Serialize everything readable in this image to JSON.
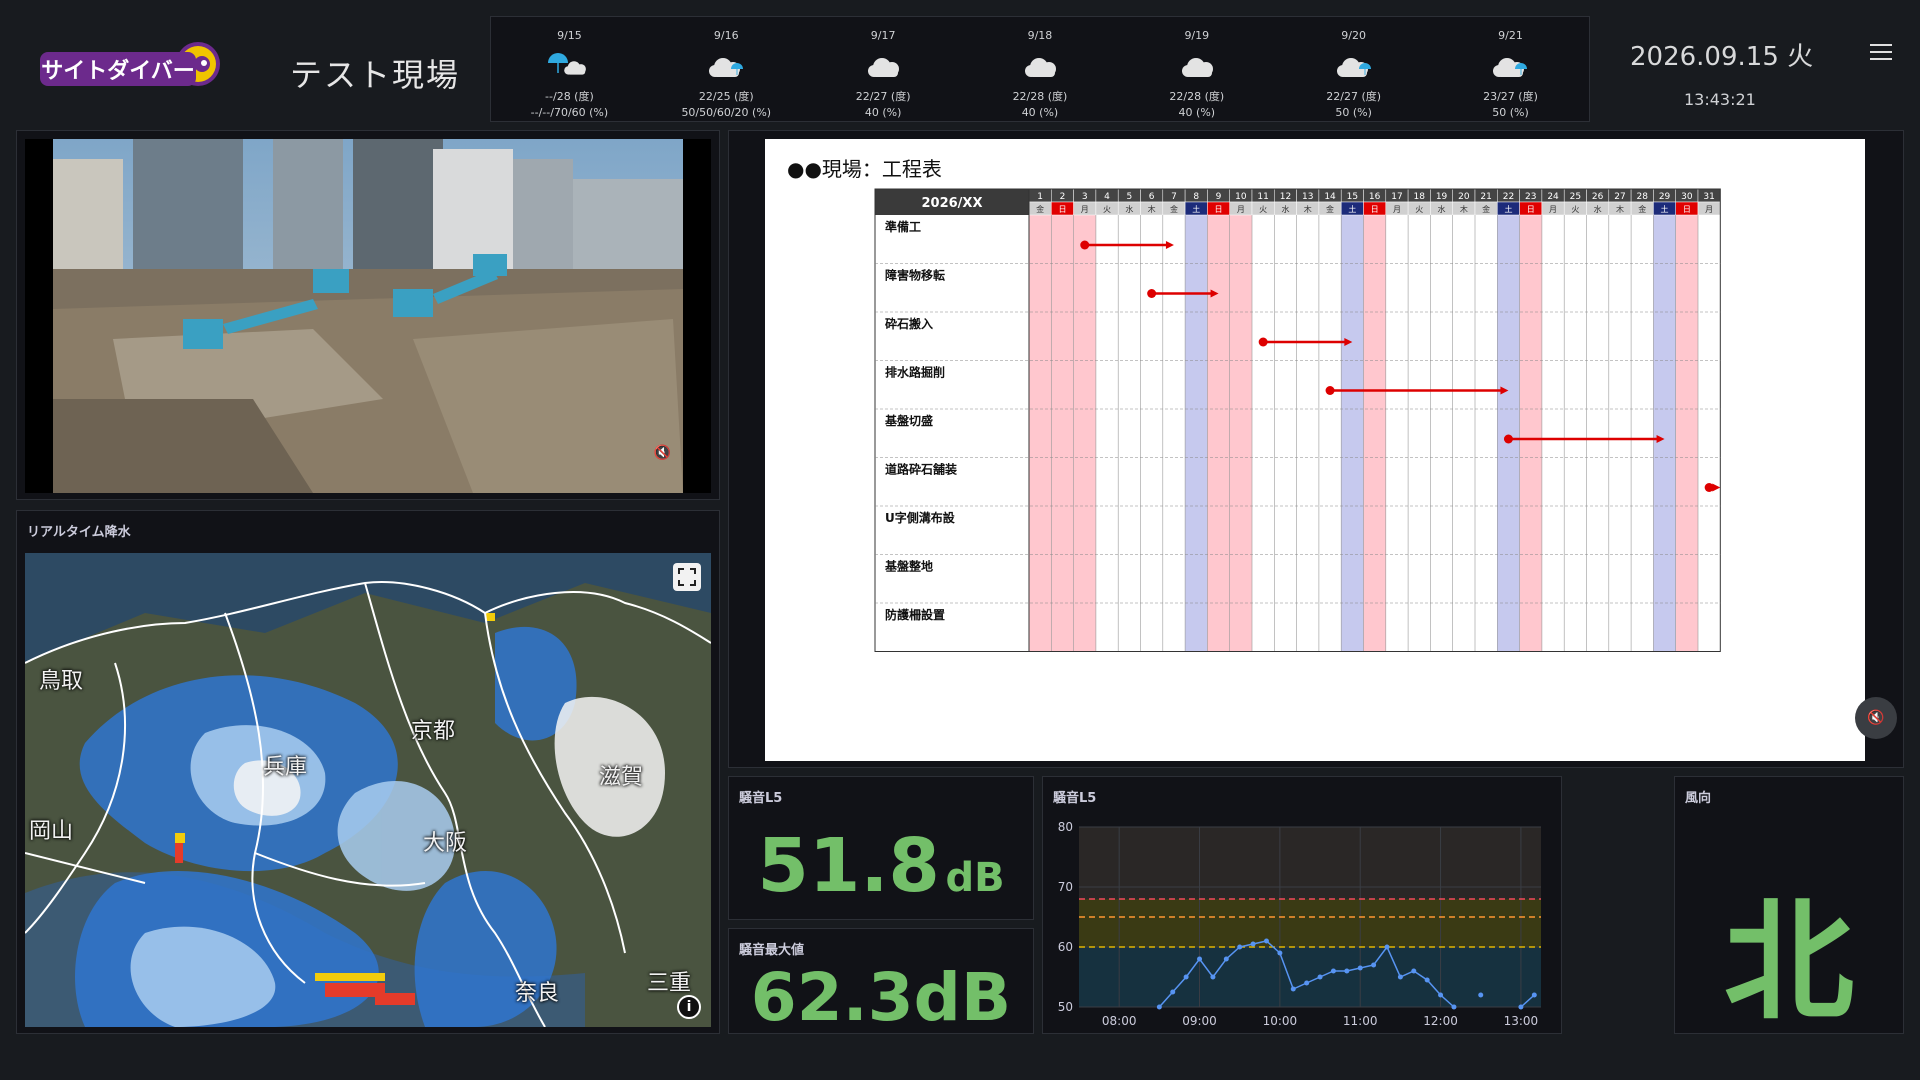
{
  "header": {
    "logo_text": "サイトダイバー",
    "site_title": "テスト現場",
    "date": "2026.09.15 火",
    "time": "13:43:21"
  },
  "weather": [
    {
      "date": "9/15",
      "icon": "umbrella-cloud-icon",
      "temp": "--/28 (度)",
      "rain": "--/--/70/60 (%)"
    },
    {
      "date": "9/16",
      "icon": "cloud-umbrella-icon",
      "temp": "22/25 (度)",
      "rain": "50/50/60/20 (%)"
    },
    {
      "date": "9/17",
      "icon": "cloud-icon",
      "temp": "22/27 (度)",
      "rain": "40 (%)"
    },
    {
      "date": "9/18",
      "icon": "cloud-icon",
      "temp": "22/28 (度)",
      "rain": "40 (%)"
    },
    {
      "date": "9/19",
      "icon": "cloud-icon",
      "temp": "22/28 (度)",
      "rain": "40 (%)"
    },
    {
      "date": "9/20",
      "icon": "cloud-umbrella-icon",
      "temp": "22/27 (度)",
      "rain": "50 (%)"
    },
    {
      "date": "9/21",
      "icon": "cloud-umbrella-icon",
      "temp": "23/27 (度)",
      "rain": "50 (%)"
    }
  ],
  "radar": {
    "title": "リアルタイム降水",
    "labels": [
      "鳥取",
      "兵庫",
      "京都",
      "滋賀",
      "岡山",
      "大阪",
      "奈良",
      "三重"
    ],
    "info_label": "i"
  },
  "schedule": {
    "title": "●●現場：工程表",
    "month": "2026/XX",
    "days": [
      "1",
      "2",
      "3",
      "4",
      "5",
      "6",
      "7",
      "8",
      "9",
      "10",
      "11",
      "12",
      "13",
      "14",
      "15",
      "16",
      "17",
      "18",
      "19",
      "20",
      "21",
      "22",
      "23",
      "24",
      "25",
      "26",
      "27",
      "28",
      "29",
      "30",
      "31"
    ],
    "weekdays": [
      "金",
      "日",
      "月",
      "火",
      "水",
      "木",
      "金",
      "土",
      "日",
      "月",
      "火",
      "水",
      "木",
      "金",
      "土",
      "日",
      "月",
      "火",
      "水",
      "木",
      "金",
      "土",
      "日",
      "月",
      "火",
      "水",
      "木",
      "金",
      "土",
      "日",
      "月"
    ],
    "tasks": [
      {
        "name": "準備工",
        "start": 3,
        "end": 7
      },
      {
        "name": "障害物移転",
        "start": 6,
        "end": 9
      },
      {
        "name": "砕石搬入",
        "start": 11,
        "end": 15
      },
      {
        "name": "排水路掘削",
        "start": 14,
        "end": 22
      },
      {
        "name": "基盤切盛",
        "start": 22,
        "end": 29
      },
      {
        "name": "道路砕石舗装",
        "start": 31,
        "end": 32
      },
      {
        "name": "U字側溝布設",
        "start": null,
        "end": null
      },
      {
        "name": "基盤整地",
        "start": null,
        "end": null
      },
      {
        "name": "防護柵設置",
        "start": null,
        "end": null
      }
    ],
    "colors": {
      "holiday": "#ffc7ce",
      "saturday": "#c6c9ee",
      "bar": "#dd0000"
    }
  },
  "noise": {
    "l5_title": "騒音L5",
    "l5_value": "51.8",
    "l5_unit": "dB",
    "max_title": "騒音最大値",
    "max_value": "62.3dB",
    "chart_title": "騒音L5"
  },
  "wind": {
    "title": "風向",
    "value": "北"
  },
  "chart_data": {
    "type": "line",
    "x": [
      "07:45",
      "08:15",
      "08:30",
      "08:40",
      "08:50",
      "09:00",
      "09:10",
      "09:20",
      "09:30",
      "09:40",
      "09:50",
      "10:00",
      "10:10",
      "10:20",
      "10:30",
      "10:40",
      "10:50",
      "11:00",
      "11:10",
      "11:20",
      "11:30",
      "11:40",
      "11:50",
      "12:00",
      "12:10",
      "12:20",
      "12:30",
      "12:40",
      "12:50",
      "13:00",
      "13:10"
    ],
    "values": [
      48,
      49,
      50,
      52.5,
      55,
      58,
      55,
      58,
      60,
      60.5,
      61,
      59,
      53,
      54,
      55,
      56,
      56,
      56.5,
      57,
      60,
      55,
      56,
      54.5,
      52,
      50,
      48,
      52,
      49,
      48,
      50,
      52
    ],
    "xticks": [
      "08:00",
      "09:00",
      "10:00",
      "11:00",
      "12:00",
      "13:00"
    ],
    "yticks": [
      50,
      60,
      70,
      80
    ],
    "ylim": [
      50,
      80
    ],
    "thresholds": [
      {
        "value": 60,
        "color": "#e0b400"
      },
      {
        "value": 65,
        "color": "#ff9830"
      },
      {
        "value": 68,
        "color": "#f2495c"
      }
    ],
    "line_color": "#5794f2"
  }
}
